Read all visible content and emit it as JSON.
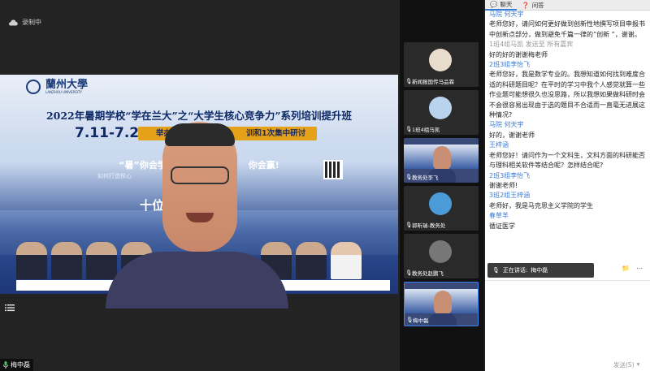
{
  "recording": {
    "label": "录制中"
  },
  "slide": {
    "logo_text": "蘭州大學",
    "logo_sub": "LANZHOU UNIVERSITY",
    "title": "2022年暑期学校“学在兰大”之“大学生核心竞争力”系列培训提升班",
    "date": "7.11-7.20",
    "band": "举办",
    "band_tail": "训和1次集中研讨",
    "slogan": "“暑”你会学，",
    "slogan_tail": "你会赢!",
    "question": "如何打造核心",
    "ten": "十位"
  },
  "main_speaker": {
    "name": "梅中磊"
  },
  "participants": [
    {
      "name": "新闻报国传马品霖",
      "color": "#d9c7b3"
    },
    {
      "name": "1班4组马凯",
      "color": "#8fb0d8"
    },
    {
      "name": "教务处李飞",
      "color": "#c98f74"
    },
    {
      "name": "郭昕瑞-教务处",
      "color": "#4a9bd8"
    },
    {
      "name": "教务处赵鹏飞",
      "color": "#555555"
    },
    {
      "name": "梅中磊",
      "color": "#c98f74"
    }
  ],
  "chat": {
    "tab_chat": "聊天",
    "tab_qa": "问答",
    "messages": [
      {
        "sender": "马院 何天宇",
        "text": "老师您好，请问如何更好做到创新性地撰写项目申报书中创新点部分，做到避免千篇一律的”创新 ”，谢谢。"
      },
      {
        "sender": "1班4组马凯  发送至 所有嘉宾",
        "grey": true,
        "text": "好的好的谢谢梅老师"
      },
      {
        "sender": "2班3组李怡飞",
        "text": "老师您好，我是数学专业的。我想知道如何找到难度合适的科研题目呢？在平时的学习中我个人感觉就算一些作业题可能想很久也没思路，所以我想如果做科研时会不会很容易出现由于选的题目不合适而一直毫无进展这种情况?"
      },
      {
        "sender": "马院 何天宇",
        "text": "好的，谢谢老师"
      },
      {
        "sender": "王梓涵",
        "text": "老师您好！请问作为一个文科生，文科方面的科研能否与理科相关软件等结合呢？怎样结合呢?"
      },
      {
        "sender": "2班3组李怡飞",
        "text": "谢谢老师!"
      },
      {
        "sender": "3班2组王梓涵",
        "text": "老师好，我是马克思主义学院的学生"
      },
      {
        "sender": "春草羊",
        "text": "循证医学"
      }
    ],
    "speaking_label": "正在讲话:",
    "speaking_name": "梅中磊",
    "send_label": "发送(S)"
  }
}
